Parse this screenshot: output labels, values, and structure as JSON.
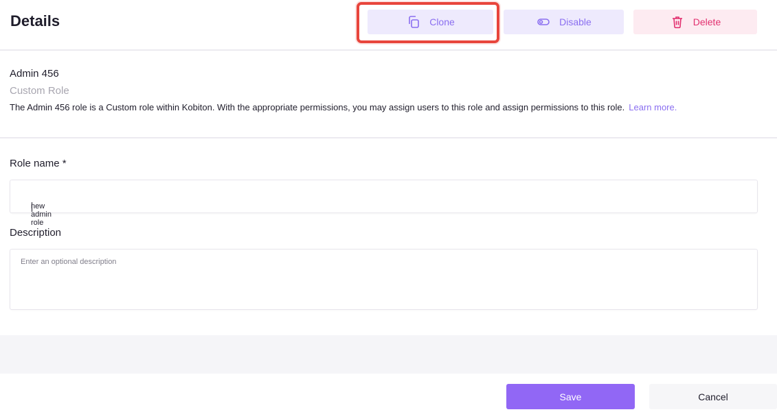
{
  "header": {
    "title": "Details",
    "actions": {
      "clone_label": "Clone",
      "disable_label": "Disable",
      "delete_label": "Delete"
    }
  },
  "role": {
    "name": "Admin 456",
    "type": "Custom Role",
    "description": "The Admin 456 role is a Custom role within Kobiton. With the appropriate permissions, you may assign users to this role and assign permissions to this role.",
    "learn_more": "Learn more."
  },
  "form": {
    "role_name_label": "Role name *",
    "role_name_value": "new admin role",
    "description_label": "Description",
    "description_placeholder": "Enter an optional description"
  },
  "footer": {
    "save_label": "Save",
    "cancel_label": "Cancel"
  },
  "colors": {
    "accent": "#9167f5",
    "accent_soft": "#eeeafd",
    "danger": "#e2306f",
    "danger_soft": "#fdebf1",
    "highlight": "#e8453c"
  },
  "icons": {
    "clone": "copy-icon",
    "disable": "toggle-icon",
    "delete": "trash-icon"
  }
}
